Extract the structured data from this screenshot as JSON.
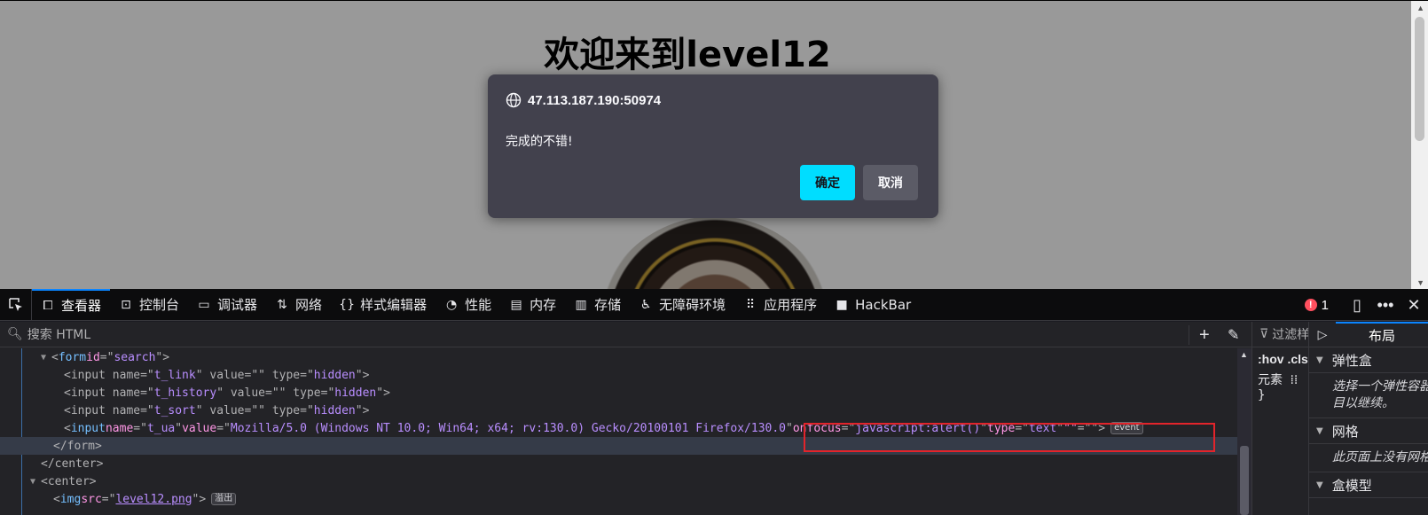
{
  "page": {
    "heading": "欢迎来到level12"
  },
  "dialog": {
    "origin": "47.113.187.190:50974",
    "message": "完成的不错!",
    "ok_label": "确定",
    "cancel_label": "取消"
  },
  "devtools": {
    "tabs": [
      {
        "label": "查看器",
        "icon": "inspector-icon",
        "active": true
      },
      {
        "label": "控制台",
        "icon": "console-icon"
      },
      {
        "label": "调试器",
        "icon": "debugger-icon"
      },
      {
        "label": "网络",
        "icon": "network-icon"
      },
      {
        "label": "样式编辑器",
        "icon": "style-editor-icon"
      },
      {
        "label": "性能",
        "icon": "performance-icon"
      },
      {
        "label": "内存",
        "icon": "memory-icon"
      },
      {
        "label": "存储",
        "icon": "storage-icon"
      },
      {
        "label": "无障碍环境",
        "icon": "accessibility-icon"
      },
      {
        "label": "应用程序",
        "icon": "application-icon"
      },
      {
        "label": "HackBar",
        "icon": "hackbar-icon"
      }
    ],
    "error_count": "1",
    "search_placeholder": "搜索 HTML",
    "tree": {
      "form_tag": "form",
      "form_id": "search",
      "inputs": [
        {
          "name": "t_link",
          "value": "",
          "type": "hidden"
        },
        {
          "name": "t_history",
          "value": "",
          "type": "hidden"
        },
        {
          "name": "t_sort",
          "value": "",
          "type": "hidden"
        },
        {
          "name": "t_ua",
          "value": "Mozilla/5.0 (Windows NT 10.0; Win64; x64; rv:130.0) Gecko/20100101 Firefox/130.0",
          "onfocus": "javascript:alert()",
          "type": "text"
        }
      ],
      "event_badge": "event",
      "form_close": "</form>",
      "center_close": "</center>",
      "center_open": "<center>",
      "img_src": "level12.png",
      "overflow_badge": "溢出"
    },
    "rules": {
      "filter_label": "过滤样式",
      "toggles": ":hov .cls",
      "element_label": "元素",
      "brace": "}"
    },
    "layout": {
      "tab_label": "布局",
      "flexbox_header": "弹性盒",
      "flexbox_hint_1": "选择一个弹性容器",
      "flexbox_hint_2": "目以继续。",
      "grid_header": "网格",
      "grid_hint": "此页面上没有网格",
      "boxmodel_header": "盒模型"
    }
  }
}
